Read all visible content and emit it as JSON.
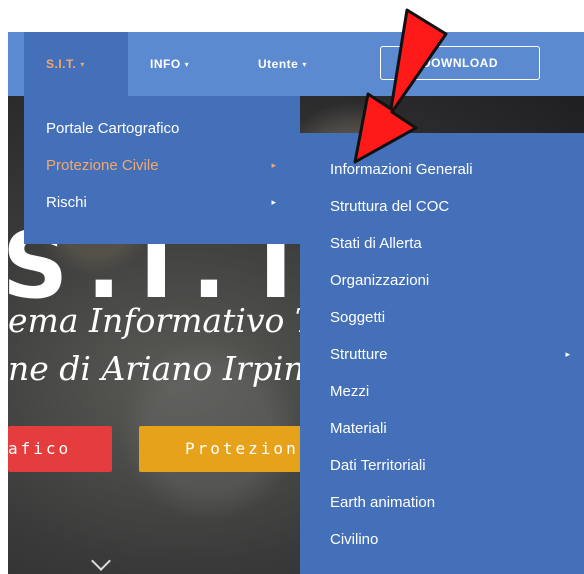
{
  "navbar": {
    "items": [
      {
        "label": "S.I.T.",
        "caret": "▾",
        "active": true
      },
      {
        "label": "INFO",
        "caret": "▾"
      },
      {
        "label": "Utente",
        "caret": "▾"
      }
    ],
    "download_label": "DOWNLOAD"
  },
  "hero": {
    "big_text": "S.I.T.",
    "line1": "ema Informativo T",
    "line2": "ne di Ariano Irpin",
    "button_red": "afico",
    "button_yellow": "Protezion"
  },
  "menu1": {
    "items": [
      {
        "label": "Portale Cartografico"
      },
      {
        "label": "Protezione Civile",
        "arrow": "▸",
        "active": true
      },
      {
        "label": "Rischi",
        "arrow": "▸"
      }
    ]
  },
  "menu2": {
    "items": [
      {
        "label": "Informazioni Generali"
      },
      {
        "label": "Struttura del COC"
      },
      {
        "label": "Stati di Allerta"
      },
      {
        "label": "Organizzazioni"
      },
      {
        "label": "Soggetti"
      },
      {
        "label": "Strutture",
        "arrow": "▸"
      },
      {
        "label": "Mezzi"
      },
      {
        "label": "Materiali"
      },
      {
        "label": "Dati Territoriali"
      },
      {
        "label": "Earth animation"
      },
      {
        "label": "Civilino"
      }
    ]
  },
  "colors": {
    "navbar": "#5c8ad1",
    "dropdown": "#4470ba",
    "active_text": "#f2a86b",
    "annotation_arrow": "#ff1a1a"
  },
  "icons": [
    "caret-down-icon",
    "caret-right-icon",
    "chevron-down-icon",
    "red-annotation-arrow-icon"
  ]
}
